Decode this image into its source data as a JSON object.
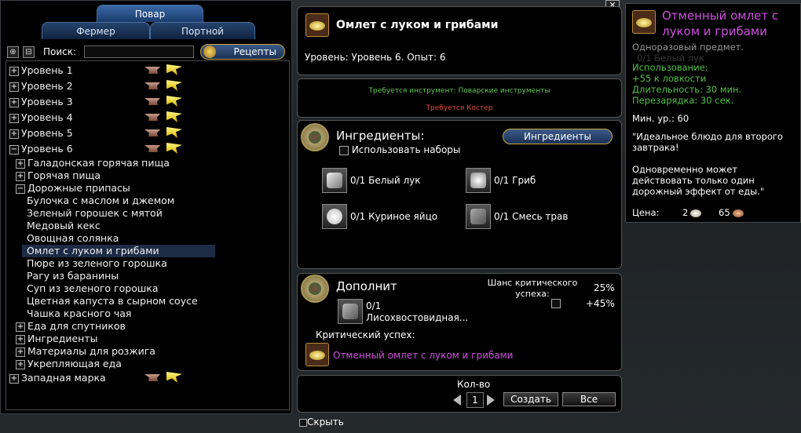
{
  "tabs": {
    "cook": "Повар",
    "farmer": "Фермер",
    "tailor": "Портной"
  },
  "search": {
    "label": "Поиск:",
    "value": ""
  },
  "recipes_button": "Рецепты",
  "tree": {
    "levels": [
      "Уровень 1",
      "Уровень 2",
      "Уровень 3",
      "Уровень 4",
      "Уровень 5",
      "Уровень 6"
    ],
    "level6_groups_top": [
      "Галадонская горячая пища",
      "Горячая пища",
      "Дорожные припасы"
    ],
    "recipes": [
      "Булочка с маслом и джемом",
      "Зеленый горошек с мятой",
      "Медовый кекс",
      "Овощная солянка",
      "Омлет с луком и грибами",
      "Пюре из зеленого горошка",
      "Рагу из баранины",
      "Суп из зеленого горошка",
      "Цветная капуста в сырном соусе",
      "Чашка красного чая"
    ],
    "level6_groups_bottom": [
      "Еда для спутников",
      "Ингредиенты",
      "Материалы для розжига",
      "Укрепляющая еда"
    ],
    "last": "Западная марка"
  },
  "recipe": {
    "title": "Омлет с луком и грибами",
    "level_line": "Уровень: Уровень 6. Опыт: 6",
    "requires_tool": "Требуется инструмент: Поварские инструменты",
    "requires_fire": "Требуется Костер"
  },
  "ingredients": {
    "title": "Ингредиенты:",
    "use_sets": "Использовать наборы",
    "button": "Ингредиенты",
    "items": [
      "0/1 Белый лук",
      "0/1 Гриб",
      "0/1 Куриное яйцо",
      "0/1 Смесь трав"
    ]
  },
  "optional": {
    "title": "Дополнит",
    "crit_chance_label": "Шанс критического успеха:",
    "crit_chance_base": "25%",
    "crit_chance_bonus": "+45%",
    "item_count": "0/1",
    "item_name": "Лисохвостовидная...",
    "crit_label": "Критический успех:",
    "crit_result": "Отменный омлет с луком и грибами"
  },
  "craft": {
    "qty_label": "Кол-во",
    "qty": "1",
    "create": "Создать",
    "all": "Все",
    "hide": "Скрыть"
  },
  "tooltip": {
    "title_l1": "Отменный омлет с",
    "title_l2": "луком и грибами",
    "kind": "Одноразовый предмет.",
    "ingredient_ghost": "0/1 Белый лук",
    "use": "Использование:",
    "effect": "+55 к ловкости",
    "duration": "Длительность: 30 мин.",
    "cooldown": "Перезарядка: 30 сек.",
    "min_level": "Мин. ур.: 60",
    "quote_l1": "\"Идеальное блюдо для второго",
    "quote_l2": "завтрака!",
    "note_l1": "Одновременно может",
    "note_l2": "действовать только один",
    "note_l3": "дорожный эффект от еды.\"",
    "price_label": "Цена:",
    "price_silver": "2",
    "price_copper": "65"
  },
  "colors": {
    "accent_gold": "#c9a640",
    "tab_blue": "#3a67a5",
    "purple": "#d050e0",
    "green": "#55c24a",
    "red": "#e24a3a"
  }
}
